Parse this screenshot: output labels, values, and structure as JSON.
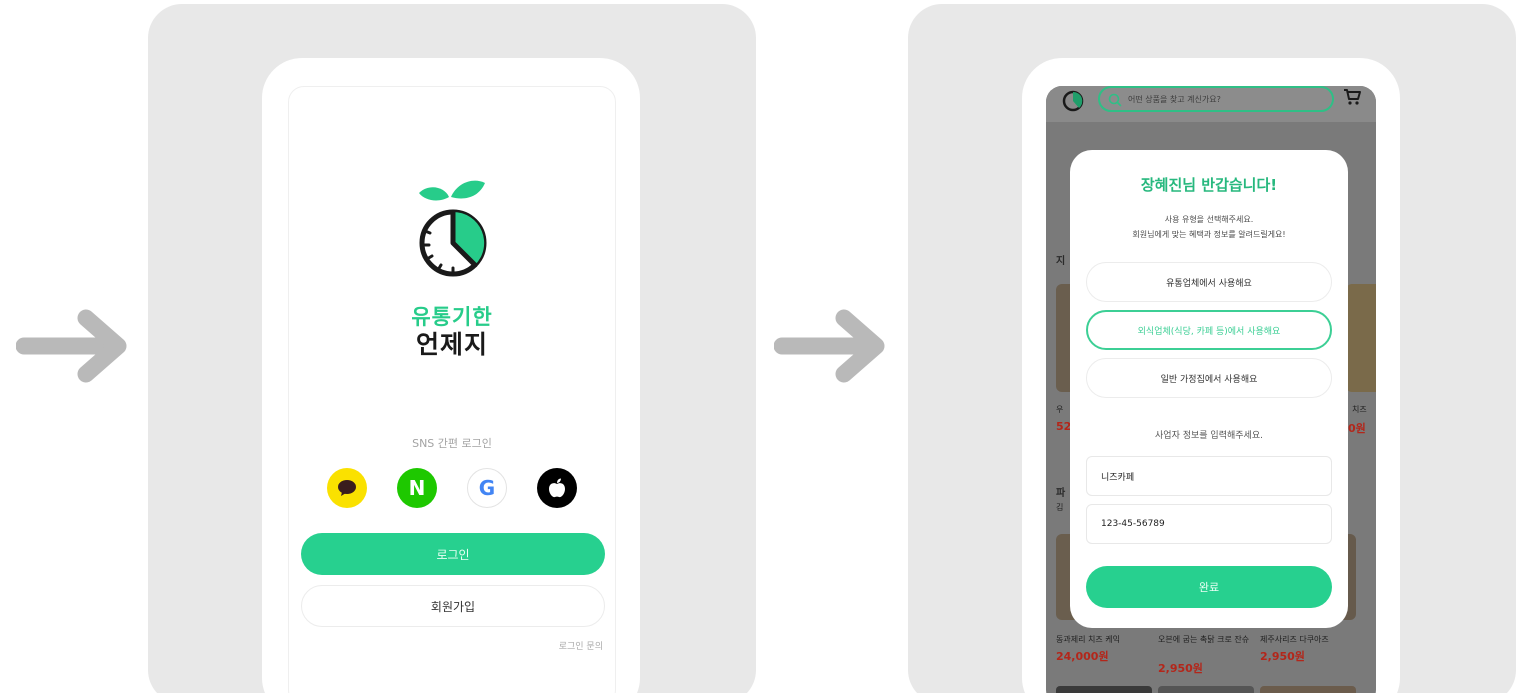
{
  "colors": {
    "brand_green": "#27d08f",
    "panel_bg": "#e8e8e8",
    "arrow": "#b9b9b9",
    "price_red": "#b3261a"
  },
  "login_screen": {
    "brand_line1": "유통기한",
    "brand_line2": "언제지",
    "sns_label": "SNS 간편 로그인",
    "sns_providers": [
      {
        "name": "kakao",
        "icon": "kakao-bubble-icon"
      },
      {
        "name": "naver",
        "icon": "naver-n-icon",
        "glyph": "N"
      },
      {
        "name": "google",
        "icon": "google-g-icon",
        "glyph": "G"
      },
      {
        "name": "apple",
        "icon": "apple-icon"
      }
    ],
    "login_button": "로그인",
    "signup_button": "회원가입",
    "inquiry_link": "로그인 문의"
  },
  "onboarding_screen": {
    "search_placeholder": "어떤 상품을 찾고 계신가요?",
    "background": {
      "section_title_1": "지",
      "section_title_2": "파",
      "section_sub_2": "김",
      "left_partial_1": "우",
      "left_partial_2": "52",
      "right_partial_name": "치즈",
      "right_partial_price": "0원",
      "products": [
        {
          "name": "동과제리 치즈 케익",
          "price": "24,000원"
        },
        {
          "name": "오븐에 굽는 촉닭 크로 잔슈",
          "price": "2,950원"
        },
        {
          "name": "제주사리즈 다쿠아즈",
          "price": "2,950원"
        }
      ]
    },
    "modal": {
      "title": "장혜진님 반갑습니다!",
      "subtitle_line1": "사용 유형을 선택해주세요.",
      "subtitle_line2": "회원님에게 맞는 혜택과 정보를 알려드릴게요!",
      "options": [
        {
          "label": "유통업체에서 사용해요",
          "selected": false
        },
        {
          "label": "외식업체(식당, 카페 등)에서 사용해요",
          "selected": true
        },
        {
          "label": "일반 가정집에서 사용해요",
          "selected": false
        }
      ],
      "business_info_label": "사업자 정보를 입력해주세요.",
      "business_name_value": "니즈카페",
      "business_number_value": "123-45-56789",
      "done_button": "완료"
    }
  }
}
